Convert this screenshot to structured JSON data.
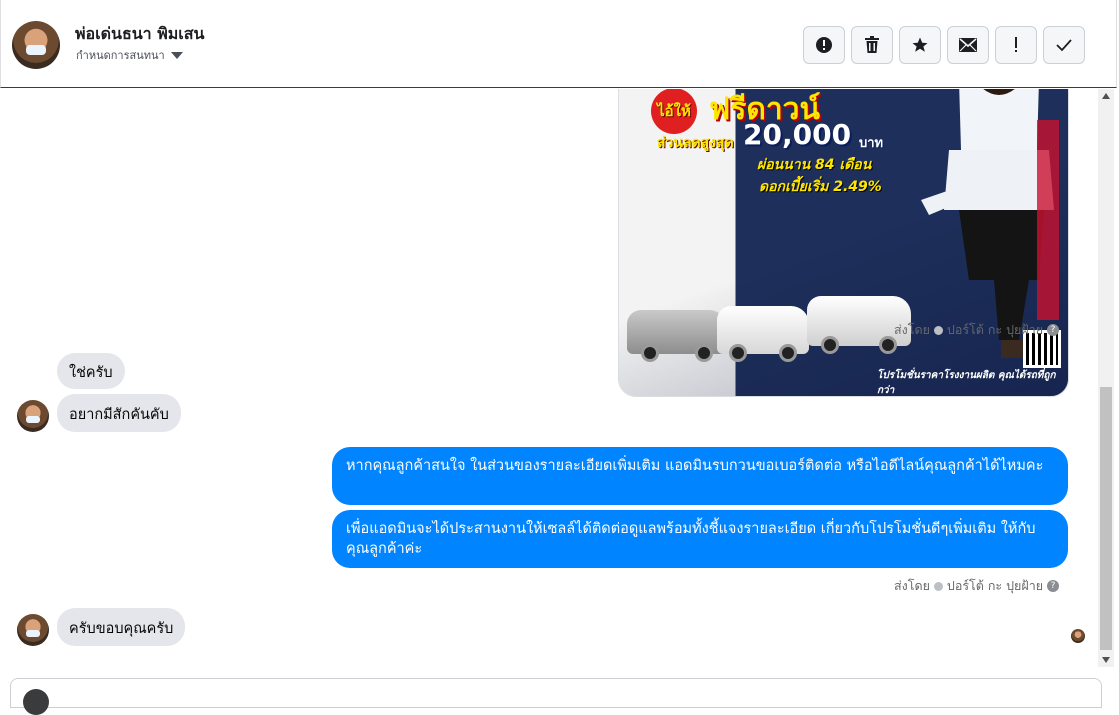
{
  "header": {
    "contact_name": "พ่อเด่นธนา พิมเสน",
    "contact_subtitle": "กำหนดการสนทนา",
    "tools": [
      {
        "icon": "alert-circle-icon"
      },
      {
        "icon": "trash-icon"
      },
      {
        "icon": "star-icon"
      },
      {
        "icon": "mail-icon"
      },
      {
        "icon": "exclamation-icon"
      },
      {
        "icon": "check-icon"
      }
    ]
  },
  "ad": {
    "badge": "ไอ้ให้",
    "headline": "ฟรีดาวน์",
    "discount_label": "ส่วนลดสูงสุด",
    "discount_amount": "20,000",
    "discount_unit": "บาท",
    "installment": "ผ่อนนาน 84 เดือน",
    "interest": "ดอกเบี้ยเริ่ม 2.49%",
    "footer": "โปรโมชั่นราคาโรงงานผลิต คุณได้รถที่ถูกกว่า"
  },
  "thread": {
    "sent_by_1": "ส่งโดย",
    "sender_1": "ปอร์โต้ กะ ปุยฝ้าย",
    "sent_by_2": "ส่งโดย",
    "sender_2": "ปอร์โต้ กะ ปุยฝ้าย",
    "incoming_1": "ใช่ครับ",
    "incoming_2": "อยากมีสักคันคับ",
    "outgoing_1": "หากคุณลูกค้าสนใจ ในส่วนของรายละเอียดเพิ่มเติม แอดมินรบกวนขอเบอร์ติดต่อ หรือไอดีไลน์คุณลูกค้าได้ไหมคะ",
    "outgoing_2": "เพื่อแอดมินจะได้ประสานงานให้เซลล์ได้ติดต่อดูแลพร้อมทั้งชี้แจงรายละเอียด เกี่ยวกับโปรโมชั่นดีๆเพิ่มเติม ให้กับคุณลูกค้าค่ะ",
    "incoming_3": "ครับขอบคุณครับ",
    "help_icon_label": "?"
  },
  "colors": {
    "outgoing_bubble": "#0084ff",
    "incoming_bubble": "#e4e6eb",
    "meta_text": "#65676b"
  }
}
